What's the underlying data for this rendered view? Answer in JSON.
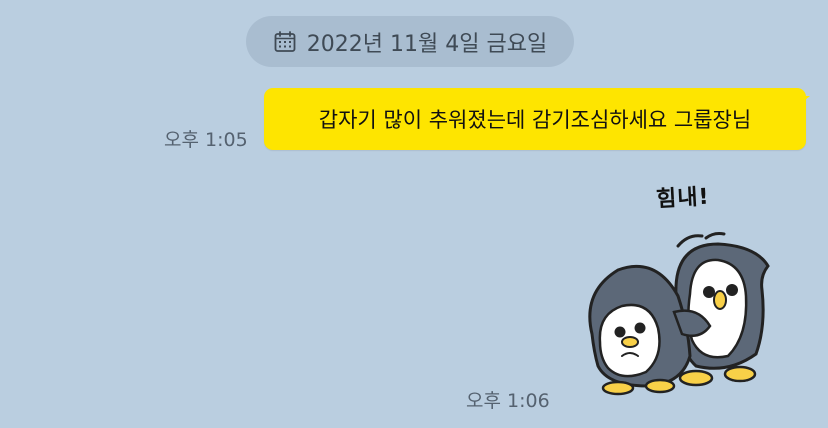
{
  "date_divider": {
    "icon": "calendar-icon",
    "text": "2022년 11월 4일 금요일"
  },
  "messages": [
    {
      "sender": "me",
      "text": "갑자기 많이 추워졌는데 감기조심하세요 그룹장님",
      "time": "오후 1:05",
      "bubble_color": "#fee500"
    },
    {
      "sender": "me",
      "type": "sticker",
      "sticker_caption": "힘내!",
      "sticker_icon": "penguins-sticker-icon",
      "time": "오후 1:06"
    }
  ],
  "colors": {
    "background": "#bacee0",
    "date_pill": "#a9bdd0",
    "bubble": "#fee500"
  }
}
